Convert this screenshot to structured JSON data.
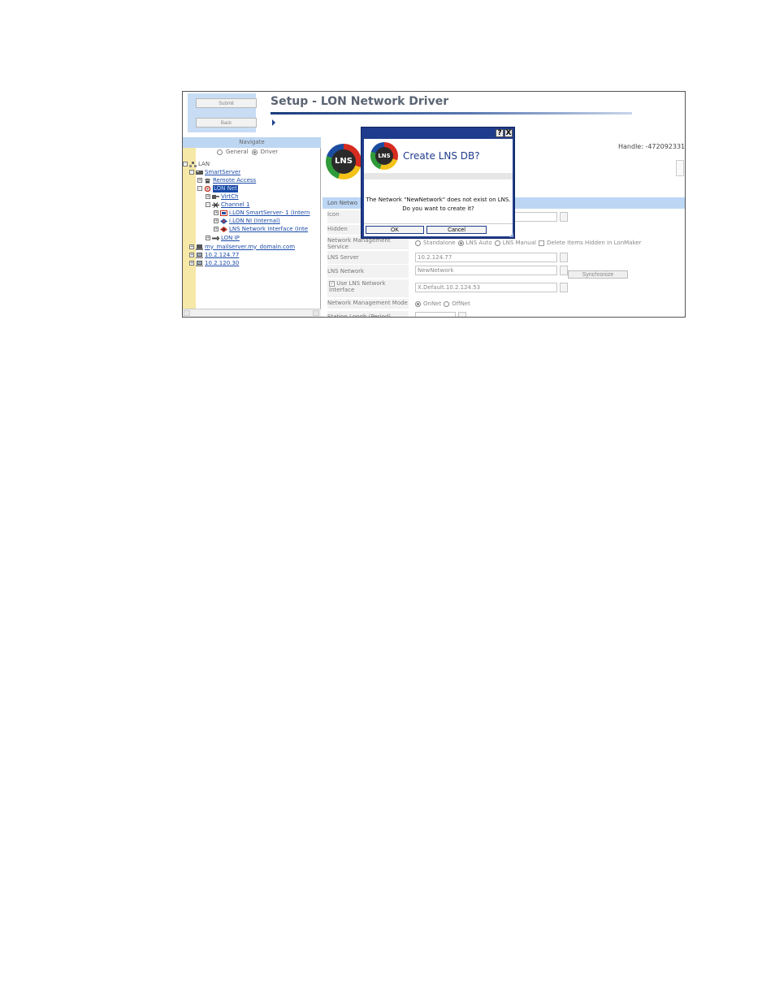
{
  "buttons": {
    "submit": "Submit",
    "back": "Back"
  },
  "page_title": "Setup - LON Network Driver",
  "navigate": {
    "header": "Navigate",
    "radio_general": "General",
    "radio_driver": "Driver",
    "tree": [
      {
        "label": "LAN",
        "icon": "network-icon",
        "expander": "-"
      },
      {
        "label": "SmartServer",
        "icon": "server-icon",
        "expander": "-"
      },
      {
        "label": "Remote Access",
        "icon": "phone-icon",
        "expander": "+"
      },
      {
        "label": "LON Net",
        "icon": "lon-net-icon",
        "expander": "-"
      },
      {
        "label": "VirtCh",
        "icon": "virtual-channel-icon",
        "expander": "+"
      },
      {
        "label": "Channel 1",
        "icon": "channel-icon",
        "expander": "-"
      },
      {
        "label": "i.LON SmartServer- 1 (Intern",
        "icon": "device-icon",
        "expander": "+"
      },
      {
        "label": "i.LON NI (Internal)",
        "icon": "ni-icon",
        "expander": "+"
      },
      {
        "label": "LNS Network Interface (Inte",
        "icon": "lns-interface-icon",
        "expander": "+"
      },
      {
        "label": "LON IP",
        "icon": "lon-ip-icon",
        "expander": "+"
      },
      {
        "label": "my_mailserver.my_domain.com",
        "icon": "mail-server-icon",
        "expander": "+"
      },
      {
        "label": "10.2.124.77",
        "icon": "pc-icon",
        "expander": "+"
      },
      {
        "label": "10.2.120.30",
        "icon": "pc-icon",
        "expander": "+"
      }
    ]
  },
  "content": {
    "logo_text": "LNS",
    "handle": "Handle: -472092331",
    "section": "Lon Netwo",
    "fields": {
      "icon_label": "Icon",
      "hidden_label": "Hidden",
      "nms_label": "Network Management Service",
      "nms_options": [
        "Standalone",
        "LNS Auto",
        "LNS Manual"
      ],
      "delete_hidden": "Delete Items Hidden in LonMaker",
      "lns_server_label": "LNS Server",
      "lns_server_value": "10.2.124.77",
      "lns_network_label": "LNS Network",
      "lns_network_value": "NewNetwork",
      "synchronize": "Synchronize",
      "use_lns_ni_label": "Use LNS Network Interface",
      "use_lns_ni_value": "X.Default.10.2.124.53",
      "nmm_label": "Network Management Mode",
      "nmm_options": [
        "OnNet",
        "OffNet"
      ],
      "truncated_label": "Station Longh (Period)"
    }
  },
  "dialog": {
    "help": "?",
    "close": "X",
    "logo_text": "LNS",
    "title": "Create LNS DB?",
    "message_line1": "The Network \"NewNetwork\" does not exist on LNS.",
    "message_line2": "Do you want to create it?",
    "ok": "OK",
    "cancel": "Cancel"
  }
}
